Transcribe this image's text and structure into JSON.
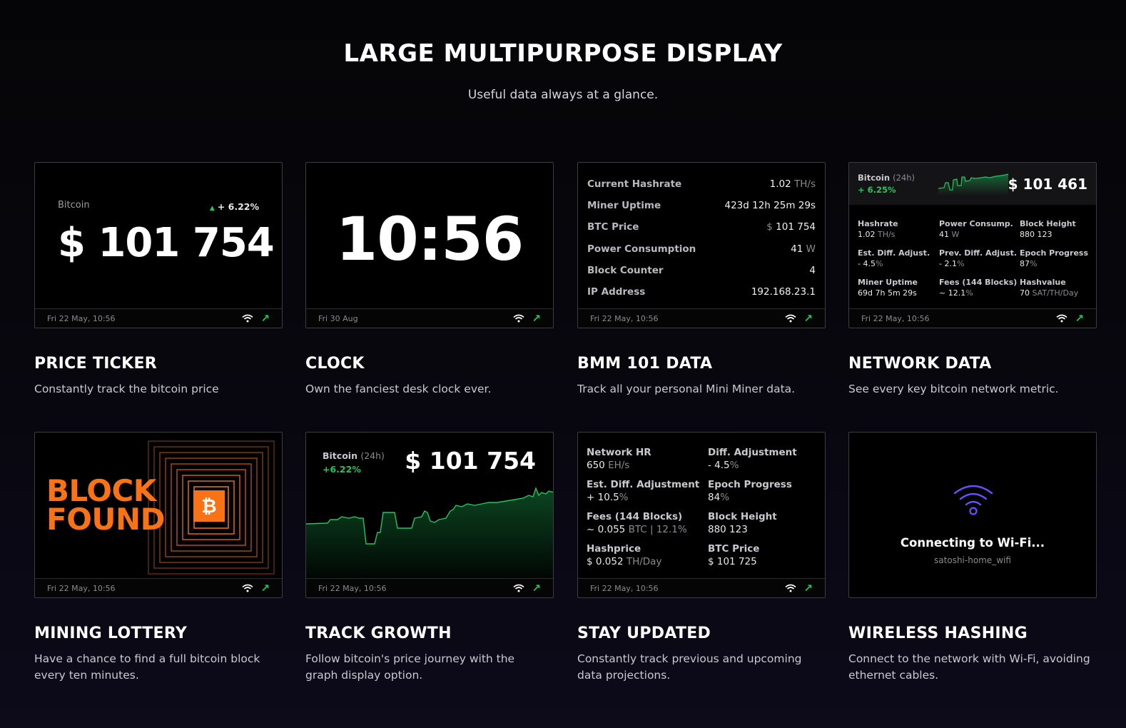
{
  "page": {
    "title": "LARGE MULTIPURPOSE DISPLAY",
    "subtitle": "Useful data always at a glance."
  },
  "colors": {
    "accent_green": "#22c55e",
    "block_orange": "#f97316",
    "wifi_purple": "#6d4cff"
  },
  "icons": {
    "wifi": "wifi-icon",
    "trend": "trend-up-arrow-icon",
    "bitcoin": "bitcoin-icon"
  },
  "cards": {
    "price_ticker": {
      "title": "PRICE TICKER",
      "desc": "Constantly track the bitcoin price",
      "label": "Bitcoin",
      "change": "+ 6.22%",
      "price": "$ 101 754",
      "footer": "Fri 22 May, 10:56"
    },
    "clock": {
      "title": "CLOCK",
      "desc": "Own the fanciest desk clock ever.",
      "time": "10:56",
      "footer": "Fri 30 Aug"
    },
    "bmm": {
      "title": "BMM 101 DATA",
      "desc": "Track all your personal Mini Miner data.",
      "footer": "Fri 22 May, 10:56",
      "rows": [
        {
          "key": "Current Hashrate",
          "value": "1.02",
          "unit": "TH/s"
        },
        {
          "key": "Miner Uptime",
          "value": "423d 12h 25m 29s",
          "unit": ""
        },
        {
          "key": "BTC Price",
          "value": "101 754",
          "unit": "$"
        },
        {
          "key": "Power Consumption",
          "value": "41",
          "unit": "W"
        },
        {
          "key": "Block Counter",
          "value": "4",
          "unit": ""
        },
        {
          "key": "IP Address",
          "value": "192.168.23.1",
          "unit": ""
        }
      ]
    },
    "network": {
      "title": "NETWORK DATA",
      "desc": "See every key bitcoin network metric.",
      "btc_label": "Bitcoin",
      "btc_period": "(24h)",
      "change": "+ 6.25%",
      "price": "$ 101 461",
      "footer": "Fri 22 May, 10:56",
      "cells": [
        {
          "key": "Hashrate",
          "value": "1.02",
          "unit": "TH/s"
        },
        {
          "key": "Power Consump.",
          "value": "41",
          "unit": "W"
        },
        {
          "key": "Block Height",
          "value": "880 123",
          "unit": ""
        },
        {
          "key": "Est. Diff. Adjust.",
          "value": "- 4.5",
          "unit": "%"
        },
        {
          "key": "Prev. Diff. Adjust.",
          "value": "- 2.1",
          "unit": "%"
        },
        {
          "key": "Epoch Progress",
          "value": "87",
          "unit": "%"
        },
        {
          "key": "Miner Uptime",
          "value": "69d 7h 5m 29s",
          "unit": ""
        },
        {
          "key": "Fees (144 Blocks)",
          "value": "~ 12.1",
          "unit": "%"
        },
        {
          "key": "Hashvalue",
          "value": "70",
          "unit": "SAT/TH/Day"
        }
      ]
    },
    "lottery": {
      "title": "MINING LOTTERY",
      "desc": "Have a chance to find a full bitcoin block every ten minutes.",
      "line1": "BLOCK",
      "line2": "FOUND",
      "footer": "Fri 22 May, 10:56"
    },
    "growth": {
      "title": "TRACK GROWTH",
      "desc": "Follow bitcoin's price journey with the graph display option.",
      "label": "Bitcoin",
      "period": "(24h)",
      "change": "+6.22%",
      "price": "$ 101 754",
      "footer": "Fri 22 May, 10:56"
    },
    "updated": {
      "title": "STAY UPDATED",
      "desc": "Constantly track previous and upcoming data projections.",
      "footer": "Fri 22 May, 10:56",
      "cells": [
        {
          "key": "Network HR",
          "value": "650",
          "unit": "EH/s"
        },
        {
          "key": "Diff. Adjustment",
          "value": "- 4.5",
          "unit": "%"
        },
        {
          "key": "Est. Diff. Adjustment",
          "value": "+ 10.5",
          "unit": "%"
        },
        {
          "key": "Epoch Progress",
          "value": "84",
          "unit": "%"
        },
        {
          "key": "Fees (144 Blocks)",
          "value": "~ 0.055",
          "unit": "BTC | 12.1%"
        },
        {
          "key": "Block Height",
          "value": "880 123",
          "unit": ""
        },
        {
          "key": "Hashprice",
          "value": "$ 0.052",
          "unit": "TH/Day"
        },
        {
          "key": "BTC Price",
          "value": "$ 101 725",
          "unit": ""
        }
      ]
    },
    "wireless": {
      "title": "WIRELESS HASHING",
      "desc": "Connect to the network with Wi-Fi, avoiding ethernet cables.",
      "status": "Connecting to Wi-Fi...",
      "ssid": "satoshi-home_wifi"
    }
  }
}
